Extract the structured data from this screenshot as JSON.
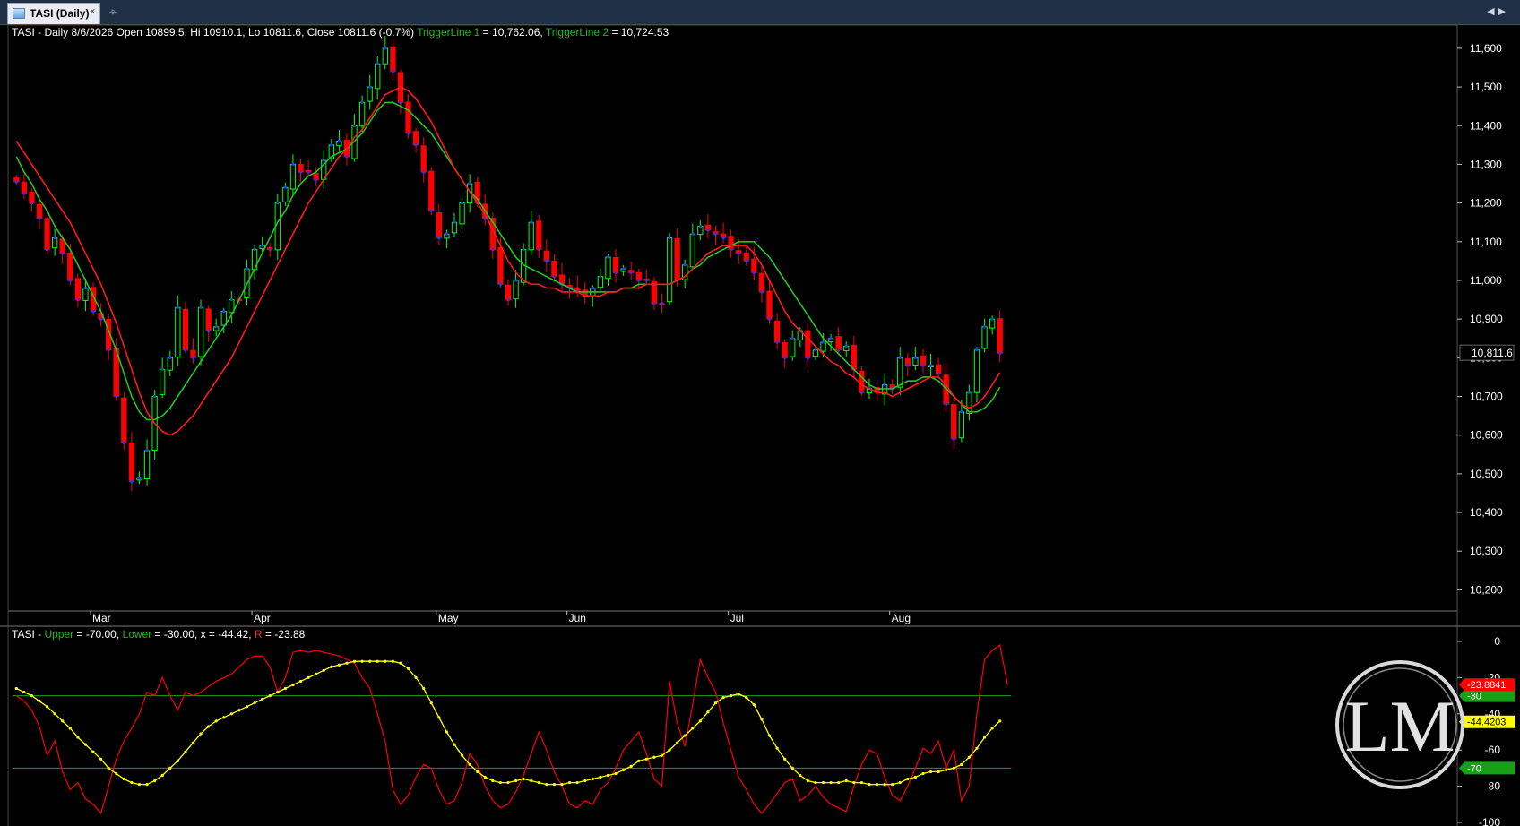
{
  "window": {
    "tab_title": "TASI (Daily)",
    "tab_close": "×",
    "new_tab_icon": "crosshair-icon",
    "nav_left": "◀",
    "nav_right": "▶"
  },
  "price_header": {
    "text": "TASI - Daily 8/6/2026 Open 10899.5, Hi 10910.1, Lo 10811.6, Close 10811.6 (-0.7%)",
    "t1_name": "TriggerLine 1",
    "t1_value": " = 10,762.06, ",
    "t2_name": "TriggerLine 2",
    "t2_value": " = 10,724.53"
  },
  "indicator_header": {
    "prefix": "TASI - ",
    "upper_name": "Upper",
    "upper_value": " = -70.00, ",
    "lower_name": "Lower",
    "lower_value": " = -30.00, ",
    "x_name": "x",
    "x_value": " = -44.42, ",
    "r_name": "R",
    "r_value": " = -23.88"
  },
  "colors": {
    "bull": "#00ff00",
    "bear": "#ff0000",
    "trigger1": "#ff1a1a",
    "trigger2": "#22c622",
    "x_line": "#ffff00",
    "r_line": "#ff0000",
    "bands": "#1fa01f",
    "price_tag": "#ffffff",
    "logo": "#cccccc"
  },
  "chart_data": [
    {
      "type": "candlestick",
      "title": "TASI - Daily",
      "x_labels": [
        "Mar",
        "Apr",
        "May",
        "Jun",
        "Jul",
        "Aug"
      ],
      "y_ticks": [
        10200,
        10300,
        10400,
        10500,
        10600,
        10700,
        10800,
        10900,
        11000,
        11100,
        11200,
        11300,
        11400,
        11500,
        11600
      ],
      "y_tick_labels": [
        "10,200",
        "10,300",
        "10,400",
        "10,500",
        "10,600",
        "10,700",
        "10,800",
        "10,900",
        "11,000",
        "11,100",
        "11,200",
        "11,300",
        "11,400",
        "11,500",
        "11,600"
      ],
      "last_price_label": "10,811.6",
      "ylim": [
        10150,
        11660
      ],
      "closes": [
        11255,
        11225,
        11200,
        11160,
        11080,
        11110,
        11070,
        11000,
        10950,
        10980,
        10920,
        10900,
        10820,
        10700,
        10580,
        10480,
        10490,
        10560,
        10700,
        10770,
        10800,
        10930,
        10820,
        10800,
        10930,
        10870,
        10880,
        10920,
        10950,
        10950,
        11030,
        11080,
        11090,
        11080,
        11200,
        11240,
        11300,
        11280,
        11280,
        11260,
        11310,
        11350,
        11360,
        11320,
        11400,
        11460,
        11500,
        11560,
        11600,
        11540,
        11460,
        11380,
        11350,
        11280,
        11180,
        11110,
        11120,
        11150,
        11200,
        11250,
        11200,
        11160,
        11080,
        10990,
        10950,
        11000,
        11080,
        11150,
        11080,
        11050,
        11010,
        10990,
        10980,
        10970,
        10960,
        10980,
        11010,
        11060,
        11020,
        11030,
        11020,
        11000,
        11000,
        10940,
        10940,
        11110,
        11000,
        11040,
        11120,
        11140,
        11130,
        11120,
        11110,
        11080,
        11070,
        11050,
        11020,
        10970,
        10900,
        10840,
        10800,
        10850,
        10870,
        10800,
        10820,
        10840,
        10850,
        10820,
        10830,
        10770,
        10710,
        10720,
        10710,
        10730,
        10720,
        10800,
        10780,
        10800,
        10780,
        10780,
        10760,
        10680,
        10590,
        10660,
        10710,
        10820,
        10880,
        10900,
        10812
      ],
      "trigger_line_1": [
        11360,
        11330,
        11300,
        11270,
        11240,
        11210,
        11180,
        11150,
        11110,
        11070,
        11030,
        10990,
        10940,
        10890,
        10830,
        10770,
        10710,
        10660,
        10630,
        10610,
        10600,
        10610,
        10630,
        10650,
        10680,
        10710,
        10740,
        10770,
        10800,
        10840,
        10880,
        10920,
        10960,
        11000,
        11040,
        11080,
        11120,
        11160,
        11200,
        11230,
        11260,
        11290,
        11320,
        11340,
        11370,
        11390,
        11420,
        11450,
        11480,
        11490,
        11500,
        11490,
        11470,
        11440,
        11410,
        11370,
        11330,
        11290,
        11260,
        11230,
        11200,
        11170,
        11130,
        11090,
        11050,
        11020,
        11000,
        10990,
        10990,
        10980,
        10980,
        10970,
        10970,
        10970,
        10960,
        10960,
        10960,
        10970,
        10970,
        10980,
        10980,
        10980,
        10990,
        10990,
        10990,
        10990,
        11000,
        11010,
        11030,
        11050,
        11070,
        11080,
        11090,
        11090,
        11090,
        11090,
        11070,
        11040,
        11000,
        10960,
        10920,
        10890,
        10870,
        10850,
        10830,
        10810,
        10790,
        10780,
        10760,
        10750,
        10730,
        10720,
        10710,
        10710,
        10700,
        10710,
        10720,
        10730,
        10740,
        10750,
        10750,
        10730,
        10700,
        10680,
        10670,
        10680,
        10700,
        10730,
        10762
      ],
      "trigger_line_2": [
        11320,
        11280,
        11250,
        11210,
        11180,
        11140,
        11110,
        11080,
        11040,
        11000,
        10960,
        10920,
        10870,
        10820,
        10760,
        10700,
        10660,
        10640,
        10640,
        10650,
        10670,
        10700,
        10730,
        10760,
        10790,
        10820,
        10850,
        10880,
        10910,
        10950,
        10990,
        11030,
        11070,
        11110,
        11150,
        11180,
        11220,
        11250,
        11270,
        11280,
        11300,
        11320,
        11330,
        11340,
        11360,
        11380,
        11410,
        11440,
        11460,
        11460,
        11450,
        11440,
        11420,
        11400,
        11380,
        11350,
        11320,
        11290,
        11260,
        11230,
        11210,
        11180,
        11150,
        11120,
        11090,
        11060,
        11040,
        11030,
        11020,
        11010,
        11000,
        10990,
        10980,
        10970,
        10970,
        10970,
        10970,
        10970,
        10970,
        10980,
        10980,
        10990,
        10990,
        10990,
        10990,
        10990,
        11000,
        11010,
        11030,
        11040,
        11060,
        11070,
        11080,
        11090,
        11100,
        11100,
        11100,
        11080,
        11060,
        11030,
        11000,
        10970,
        10940,
        10910,
        10880,
        10850,
        10830,
        10810,
        10790,
        10770,
        10750,
        10730,
        10720,
        10720,
        10720,
        10730,
        10740,
        10740,
        10750,
        10750,
        10740,
        10720,
        10700,
        10680,
        10660,
        10660,
        10670,
        10690,
        10724
      ],
      "trigger_line_1_name": "TriggerLine 1",
      "trigger_line_2_name": "TriggerLine 2"
    },
    {
      "type": "line",
      "title": "TASI",
      "ylim": [
        -100,
        0
      ],
      "y_ticks": [
        0,
        -20,
        -40,
        -60,
        -80,
        -100
      ],
      "y_tick_labels": [
        "0",
        "-20",
        "-40",
        "-60",
        "-80",
        "-100"
      ],
      "upper": -70,
      "lower": -30,
      "upper_label": "-70",
      "lower_label": "-30",
      "x_label": "-44.4203",
      "r_label": "-23.8841",
      "series": [
        {
          "name": "x",
          "values": [
            -26,
            -28,
            -30,
            -33,
            -36,
            -40,
            -44,
            -48,
            -53,
            -57,
            -61,
            -65,
            -70,
            -73,
            -76,
            -78,
            -79,
            -79,
            -77,
            -74,
            -70,
            -66,
            -61,
            -56,
            -51,
            -47,
            -44,
            -42,
            -40,
            -38,
            -36,
            -34,
            -32,
            -30,
            -28,
            -26,
            -24,
            -22,
            -20,
            -18,
            -16,
            -14,
            -13,
            -12,
            -11,
            -11,
            -11,
            -11,
            -11,
            -11,
            -12,
            -15,
            -20,
            -26,
            -34,
            -42,
            -50,
            -57,
            -63,
            -68,
            -72,
            -75,
            -77,
            -78,
            -78,
            -77,
            -76,
            -77,
            -78,
            -79,
            -79,
            -79,
            -78,
            -78,
            -77,
            -76,
            -75,
            -74,
            -73,
            -71,
            -69,
            -66,
            -65,
            -64,
            -63,
            -60,
            -56,
            -52,
            -48,
            -44,
            -39,
            -34,
            -31,
            -30,
            -29,
            -31,
            -35,
            -43,
            -52,
            -59,
            -65,
            -70,
            -74,
            -77,
            -78,
            -78,
            -78,
            -78,
            -77,
            -78,
            -78,
            -79,
            -79,
            -79,
            -79,
            -78,
            -76,
            -75,
            -73,
            -72,
            -72,
            -71,
            -70,
            -68,
            -64,
            -59,
            -53,
            -48,
            -44
          ]
        },
        {
          "name": "R",
          "values": [
            -30,
            -33,
            -38,
            -47,
            -63,
            -55,
            -72,
            -82,
            -78,
            -87,
            -90,
            -95,
            -80,
            -65,
            -55,
            -48,
            -40,
            -28,
            -30,
            -20,
            -30,
            -38,
            -28,
            -30,
            -28,
            -25,
            -22,
            -20,
            -18,
            -14,
            -10,
            -8,
            -8,
            -14,
            -28,
            -20,
            -6,
            -5,
            -6,
            -5,
            -6,
            -7,
            -8,
            -10,
            -12,
            -20,
            -26,
            -40,
            -55,
            -82,
            -90,
            -85,
            -75,
            -68,
            -70,
            -82,
            -90,
            -88,
            -78,
            -62,
            -68,
            -80,
            -88,
            -92,
            -90,
            -83,
            -74,
            -62,
            -50,
            -60,
            -72,
            -80,
            -90,
            -92,
            -88,
            -90,
            -82,
            -78,
            -70,
            -60,
            -55,
            -50,
            -62,
            -76,
            -80,
            -22,
            -45,
            -58,
            -35,
            -10,
            -20,
            -28,
            -45,
            -60,
            -75,
            -82,
            -90,
            -95,
            -90,
            -84,
            -78,
            -76,
            -88,
            -85,
            -80,
            -86,
            -90,
            -92,
            -94,
            -80,
            -68,
            -60,
            -62,
            -75,
            -85,
            -88,
            -80,
            -70,
            -59,
            -62,
            -55,
            -70,
            -60,
            -88,
            -80,
            -40,
            -10,
            -5,
            -2,
            -24
          ]
        }
      ]
    }
  ]
}
